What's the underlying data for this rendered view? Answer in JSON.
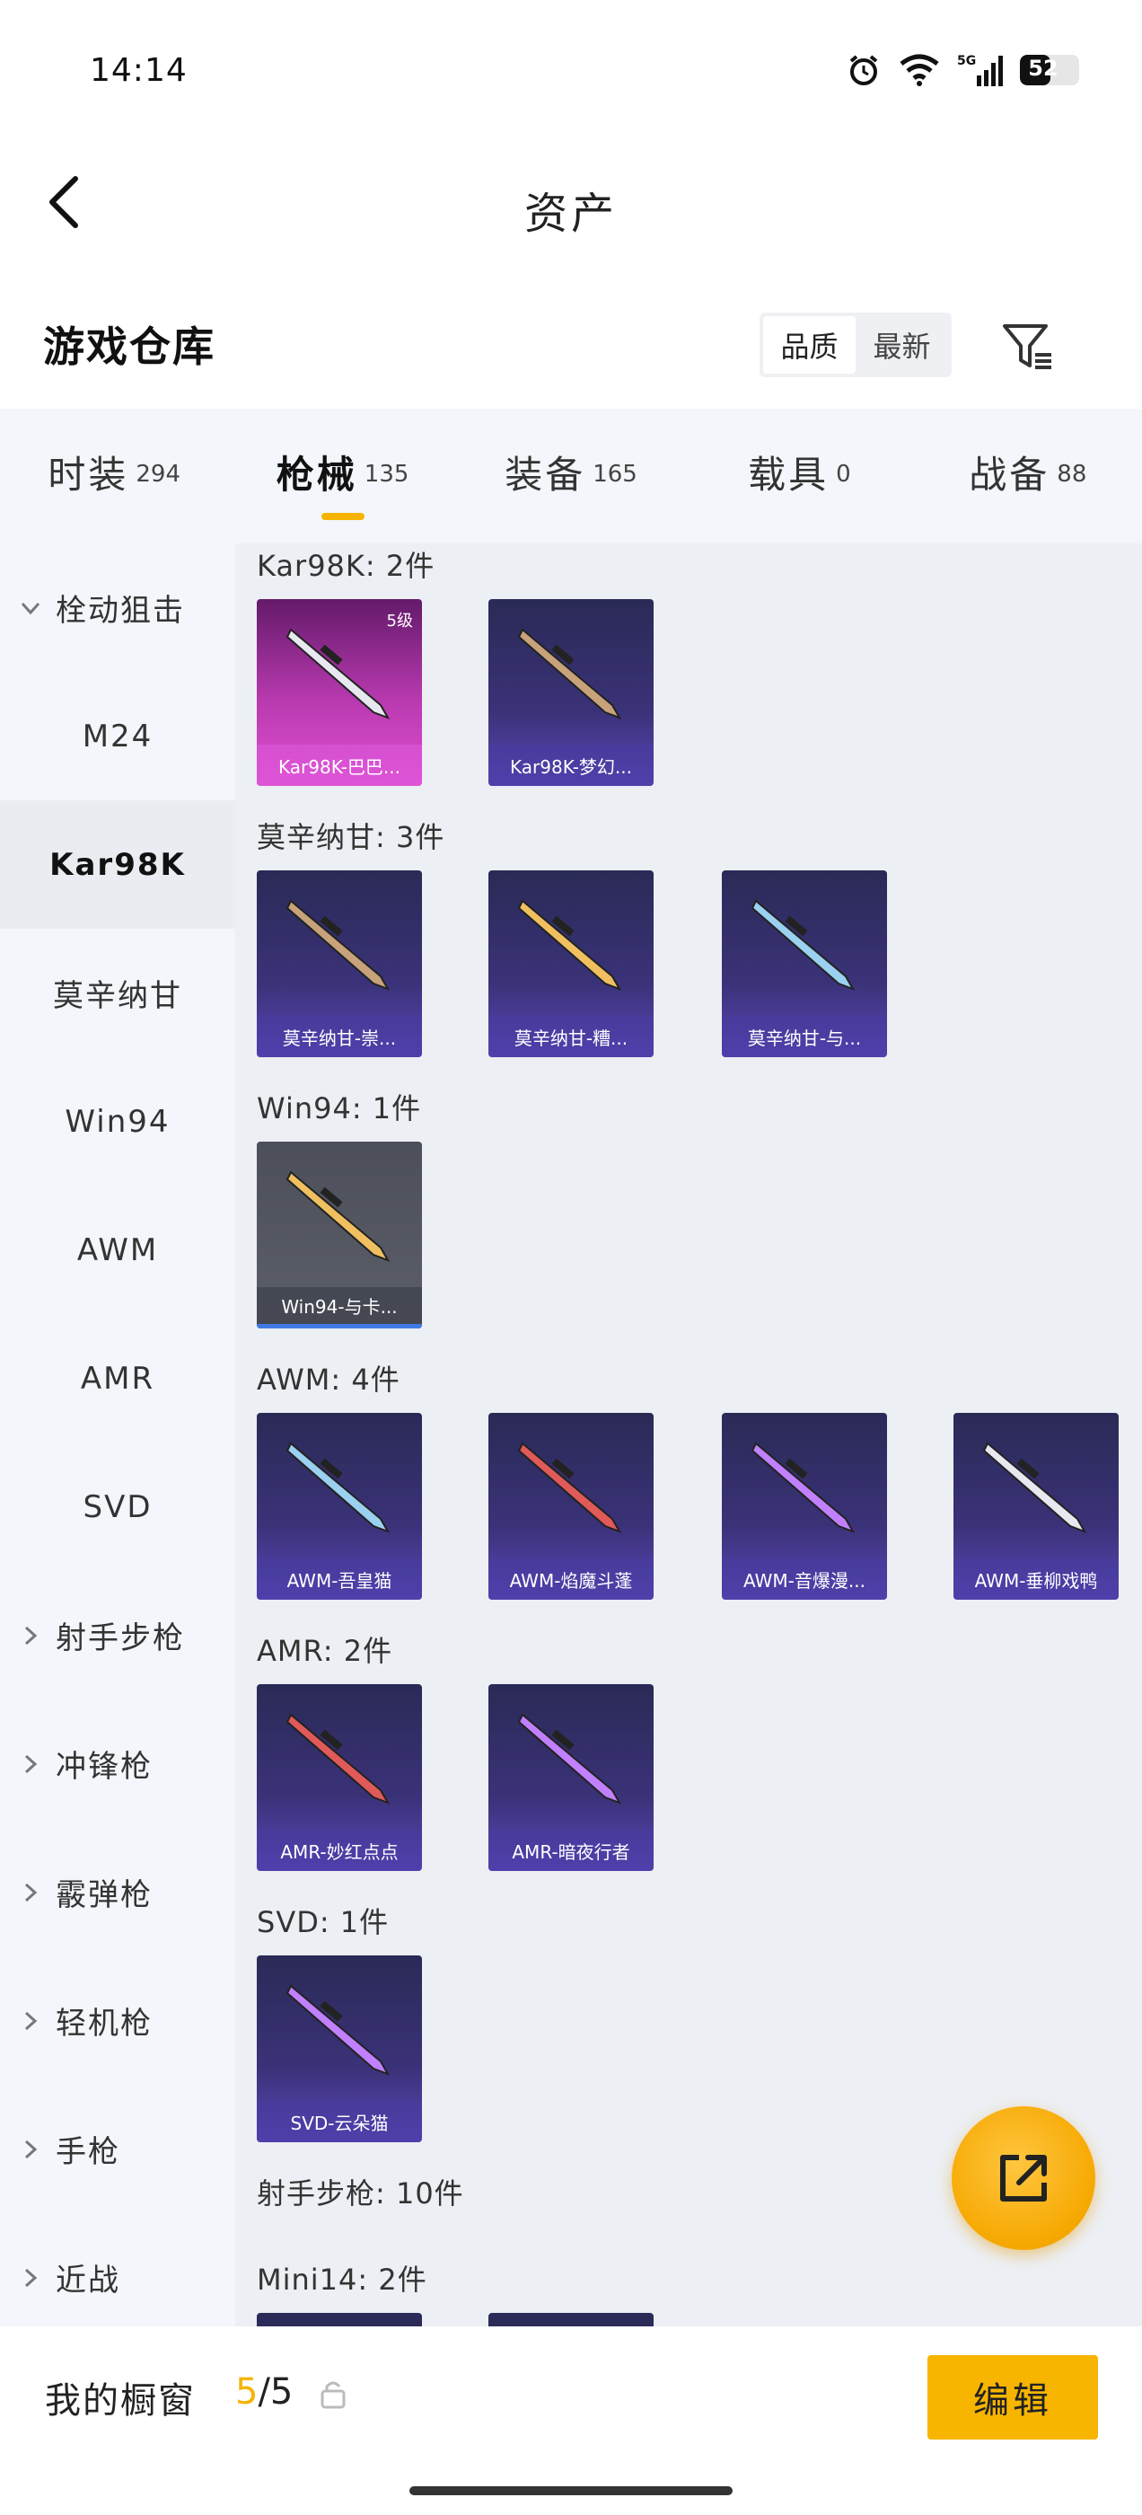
{
  "status_bar": {
    "time": "14:14",
    "battery": "52",
    "network": "5G"
  },
  "header": {
    "title": "资产"
  },
  "section": {
    "title": "游戏仓库",
    "sort_options": [
      "品质",
      "最新"
    ],
    "active_sort": 0
  },
  "tabs": [
    {
      "label": "时装",
      "count": "294"
    },
    {
      "label": "枪械",
      "count": "135",
      "active": true
    },
    {
      "label": "装备",
      "count": "165"
    },
    {
      "label": "载具",
      "count": "0"
    },
    {
      "label": "战备",
      "count": "88"
    }
  ],
  "sidebar": {
    "items": [
      {
        "label": "栓动狙击",
        "type": "group",
        "expanded": true
      },
      {
        "label": "M24",
        "type": "sub"
      },
      {
        "label": "Kar98K",
        "type": "sub",
        "selected": true
      },
      {
        "label": "莫辛纳甘",
        "type": "sub"
      },
      {
        "label": "Win94",
        "type": "sub"
      },
      {
        "label": "AWM",
        "type": "sub"
      },
      {
        "label": "AMR",
        "type": "sub"
      },
      {
        "label": "SVD",
        "type": "sub"
      },
      {
        "label": "射手步枪",
        "type": "group"
      },
      {
        "label": "冲锋枪",
        "type": "group"
      },
      {
        "label": "霰弹枪",
        "type": "group"
      },
      {
        "label": "轻机枪",
        "type": "group"
      },
      {
        "label": "手枪",
        "type": "group"
      },
      {
        "label": "近战",
        "type": "group"
      }
    ]
  },
  "groups": [
    {
      "title": "Kar98K: 2件",
      "items": [
        {
          "name": "Kar98K-巴巴...",
          "level": "5级",
          "style": "pink"
        },
        {
          "name": "Kar98K-梦幻...",
          "style": "purple"
        }
      ]
    },
    {
      "title": "莫辛纳甘: 3件",
      "items": [
        {
          "name": "莫辛纳甘-崇...",
          "style": "purple"
        },
        {
          "name": "莫辛纳甘-糟...",
          "style": "purple"
        },
        {
          "name": "莫辛纳甘-与...",
          "style": "purple"
        }
      ]
    },
    {
      "title": "Win94: 1件",
      "items": [
        {
          "name": "Win94-与卡...",
          "style": "grey"
        }
      ]
    },
    {
      "title": "AWM: 4件",
      "items": [
        {
          "name": "AWM-吾皇猫",
          "style": "purple"
        },
        {
          "name": "AWM-焰魔斗蓬",
          "style": "purple"
        },
        {
          "name": "AWM-音爆漫...",
          "style": "purple"
        },
        {
          "name": "AWM-垂柳戏鸭",
          "style": "purple"
        }
      ]
    },
    {
      "title": "AMR: 2件",
      "items": [
        {
          "name": "AMR-妙红点点",
          "style": "purple"
        },
        {
          "name": "AMR-暗夜行者",
          "style": "purple"
        }
      ]
    },
    {
      "title": "SVD: 1件",
      "items": [
        {
          "name": "SVD-云朵猫",
          "style": "purple"
        }
      ]
    },
    {
      "title": "射手步枪: 10件",
      "items": []
    },
    {
      "title": "Mini14: 2件",
      "items": []
    }
  ],
  "bottom_bar": {
    "showcase_label": "我的橱窗",
    "showcase_current": "5",
    "showcase_total": "/5",
    "edit_label": "编辑"
  },
  "colors": {
    "accent": "#f7b500",
    "sidebar_bg": "#f3f6fa",
    "content_bg": "#eceff3"
  }
}
